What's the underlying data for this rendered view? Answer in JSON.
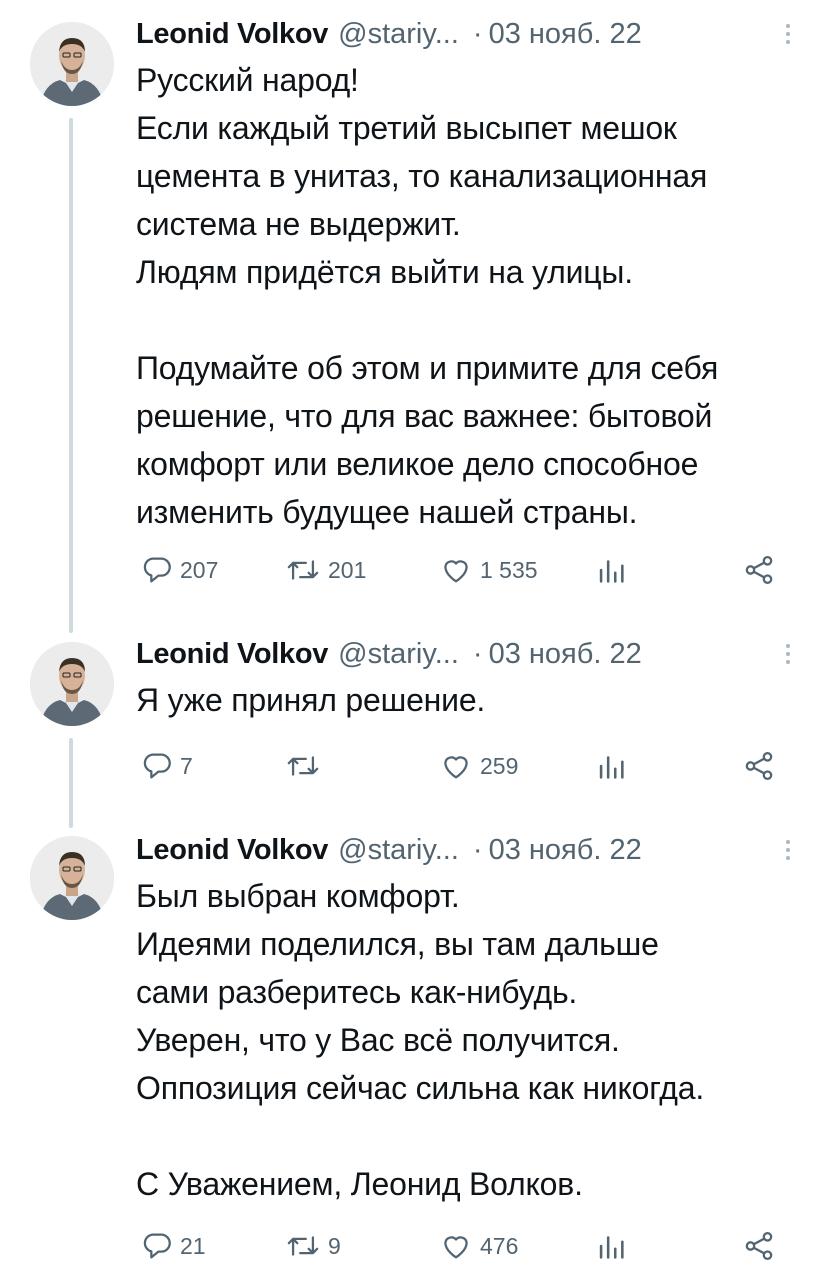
{
  "tweets": [
    {
      "author": {
        "name": "Leonid Volkov",
        "handle": "@stariy..."
      },
      "separator": "·",
      "date": "03 нояб. 22",
      "text": [
        "Русский народ!",
        "Если каждый третий высыпет мешок",
        "цемента в унитаз, то канализационная",
        "система не выдержит.",
        "Людям придётся выйти на улицы.",
        "",
        "Подумайте об этом и примите для себя",
        "решение, что для вас важнее: бытовой",
        "комфорт или великое дело способное",
        "изменить будущее нашей страны."
      ],
      "stats": {
        "replies": "207",
        "retweets": "201",
        "likes": "1 535",
        "views": ""
      }
    },
    {
      "author": {
        "name": "Leonid Volkov",
        "handle": "@stariy..."
      },
      "separator": "·",
      "date": "03 нояб. 22",
      "text": [
        "Я уже принял решение."
      ],
      "stats": {
        "replies": "7",
        "retweets": "",
        "likes": "259",
        "views": ""
      }
    },
    {
      "author": {
        "name": "Leonid Volkov",
        "handle": "@stariy..."
      },
      "separator": "·",
      "date": "03 нояб. 22",
      "text": [
        "Был выбран комфорт.",
        "Идеями поделился, вы там дальше",
        "сами разберитесь как-нибудь.",
        "Уверен, что у Вас всё получится.",
        "Оппозиция сейчас сильна как никогда.",
        "",
        "С Уважением, Леонид Волков."
      ],
      "stats": {
        "replies": "21",
        "retweets": "9",
        "likes": "476",
        "views": ""
      }
    }
  ],
  "icons": {
    "reply": "reply-icon",
    "retweet": "retweet-icon",
    "like": "heart-icon",
    "views": "views-icon",
    "share": "share-icon",
    "more": "more-options-icon"
  },
  "colors": {
    "text": "#0f1419",
    "secondary": "#536471",
    "thread_line": "#cfd9de",
    "background": "#ffffff"
  }
}
